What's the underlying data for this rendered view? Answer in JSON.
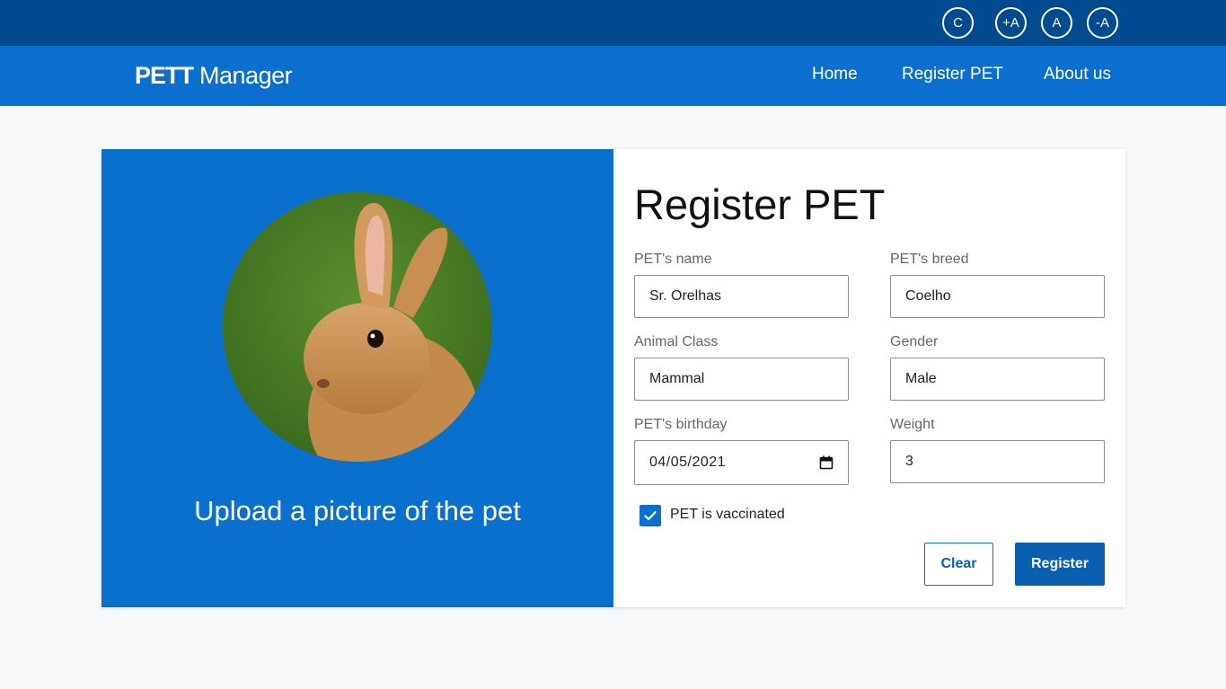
{
  "accessibility": {
    "contrast_label": "C",
    "increase_font_label": "+A",
    "reset_font_label": "A",
    "decrease_font_label": "-A"
  },
  "navbar": {
    "brand_bold": "PETT",
    "brand_light": "Manager",
    "links": [
      {
        "label": "Home"
      },
      {
        "label": "Register PET"
      },
      {
        "label": "About us"
      }
    ]
  },
  "upload": {
    "text": "Upload a picture of the pet"
  },
  "form": {
    "title": "Register PET",
    "fields": {
      "name": {
        "label": "PET's name",
        "value": "Sr. Orelhas"
      },
      "breed": {
        "label": "PET's breed",
        "value": "Coelho"
      },
      "animal_class": {
        "label": "Animal Class",
        "value": "Mammal"
      },
      "gender": {
        "label": "Gender",
        "value": "Male"
      },
      "birthday": {
        "label": "PET's birthday",
        "value": "04/05/2021"
      },
      "weight": {
        "label": "Weight",
        "value": "3"
      }
    },
    "vaccinated": {
      "label": "PET is vaccinated",
      "checked": true
    },
    "clear_label": "Clear",
    "register_label": "Register"
  },
  "colors": {
    "topbar": "#004a8f",
    "navbar": "#0a6fcf",
    "upload_panel": "#0a70cd",
    "primary_button": "#0a5fb0"
  },
  "icons": {
    "calendar": "calendar-icon",
    "check": "check-icon"
  }
}
